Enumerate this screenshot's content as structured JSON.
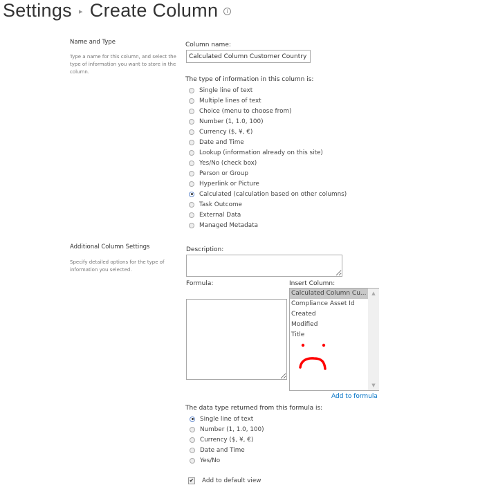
{
  "header": {
    "breadcrumb_root": "Settings",
    "title": "Create Column"
  },
  "name_type": {
    "heading": "Name and Type",
    "description": "Type a name for this column, and select the type of information you want to store in the column.",
    "column_name_label": "Column name:",
    "column_name_value": "Calculated Column Customer Country",
    "type_label": "The type of information in this column is:",
    "types": [
      {
        "label": "Single line of text",
        "checked": false
      },
      {
        "label": "Multiple lines of text",
        "checked": false
      },
      {
        "label": "Choice (menu to choose from)",
        "checked": false
      },
      {
        "label": "Number (1, 1.0, 100)",
        "checked": false
      },
      {
        "label": "Currency ($, ¥, €)",
        "checked": false
      },
      {
        "label": "Date and Time",
        "checked": false
      },
      {
        "label": "Lookup (information already on this site)",
        "checked": false
      },
      {
        "label": "Yes/No (check box)",
        "checked": false
      },
      {
        "label": "Person or Group",
        "checked": false
      },
      {
        "label": "Hyperlink or Picture",
        "checked": false
      },
      {
        "label": "Calculated (calculation based on other columns)",
        "checked": true
      },
      {
        "label": "Task Outcome",
        "checked": false
      },
      {
        "label": "External Data",
        "checked": false
      },
      {
        "label": "Managed Metadata",
        "checked": false
      }
    ]
  },
  "additional": {
    "heading": "Additional Column Settings",
    "description": "Specify detailed options for the type of information you selected.",
    "description_label": "Description:",
    "formula_label": "Formula:",
    "insert_column_label": "Insert Column:",
    "columns": [
      "Calculated Column Cu...",
      "Compliance Asset Id",
      "Created",
      "Modified",
      "Title"
    ],
    "add_to_formula": "Add to formula",
    "return_label": "The data type returned from this formula is:",
    "return_types": [
      {
        "label": "Single line of text",
        "checked": true
      },
      {
        "label": "Number (1, 1.0, 100)",
        "checked": false
      },
      {
        "label": "Currency ($, ¥, €)",
        "checked": false
      },
      {
        "label": "Date and Time",
        "checked": false
      },
      {
        "label": "Yes/No",
        "checked": false
      }
    ],
    "add_default_view": "Add to default view"
  },
  "colors": {
    "link": "#0072c6",
    "annotation": "#ff0000"
  }
}
